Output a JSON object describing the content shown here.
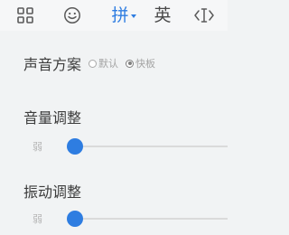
{
  "toolbar": {
    "grid_icon": "grid-icon",
    "emoji_icon": "smiley-icon",
    "pinyin_label": "拼",
    "english_label": "英",
    "cursor_icon": "cursor-move-icon"
  },
  "sound_scheme": {
    "title": "声音方案",
    "options": [
      {
        "label": "默认",
        "checked": false
      },
      {
        "label": "快板",
        "checked": true
      }
    ]
  },
  "volume": {
    "title": "音量调整",
    "min_label": "弱",
    "level": 0.0
  },
  "vibration": {
    "title": "振动调整",
    "min_label": "弱",
    "level": 0.0
  },
  "colors": {
    "accent": "#2e7de1",
    "background": "#f1f3f4",
    "text": "#3c3c3c",
    "muted": "#a4a4a4"
  }
}
